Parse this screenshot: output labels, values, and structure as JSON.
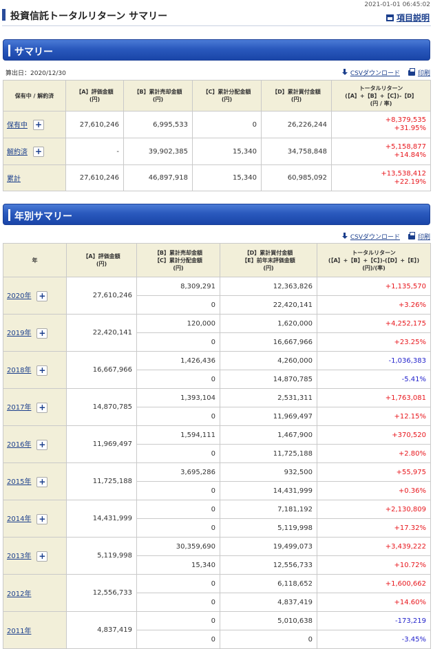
{
  "timestamp": "2021-01-01 06:45:02",
  "page_title": "投資信託トータルリターン サマリー",
  "help_link": "項目説明",
  "summary": {
    "heading": "サマリー",
    "calc_date": "算出日：2020/12/30",
    "csv_label": "CSVダウンロード",
    "print_label": "印刷",
    "headers": {
      "col0": "保有中 / 解約済",
      "colA": "【A】評価金額\n(円)",
      "colB": "【B】累計売却金額\n(円)",
      "colC": "【C】累計分配金額\n(円)",
      "colD": "【D】累計買付金額\n(円)",
      "colE": "トータルリターン\n(【A】+【B】+【C】)-【D】\n(円 / 率)"
    },
    "rows": [
      {
        "label": "保有中",
        "expand": "+",
        "a": "27,610,246",
        "b": "6,995,533",
        "c": "0",
        "d": "26,226,244",
        "ret_amount": "+8,379,535",
        "ret_rate": "+31.95%"
      },
      {
        "label": "解約済",
        "expand": "+",
        "a": "-",
        "b": "39,902,385",
        "c": "15,340",
        "d": "34,758,848",
        "ret_amount": "+5,158,877",
        "ret_rate": "+14.84%"
      },
      {
        "label": "累計",
        "a": "27,610,246",
        "b": "46,897,918",
        "c": "15,340",
        "d": "60,985,092",
        "ret_amount": "+13,538,412",
        "ret_rate": "+22.19%"
      }
    ]
  },
  "yearly": {
    "heading": "年別サマリー",
    "csv_label": "CSVダウンロード",
    "print_label": "印刷",
    "headers": {
      "year": "年",
      "a": "【A】評価金額\n(円)",
      "bc": "【B】累計売却金額\n【C】累計分配金額\n(円)",
      "de": "【D】累計買付金額\n【E】前年末評価金額\n(円)",
      "ret": "トータルリターン\n(【A】+【B】+【C】)-(【D】+【E】)\n(円)/(率)"
    },
    "rows": [
      {
        "year": "2020年",
        "expand": "+",
        "a": "27,610,246",
        "b": "8,309,291",
        "c": "0",
        "d": "12,363,826",
        "e": "22,420,141",
        "ret_amount": "+1,135,570",
        "ret_rate": "+3.26%",
        "sign": "pos"
      },
      {
        "year": "2019年",
        "expand": "+",
        "a": "22,420,141",
        "b": "120,000",
        "c": "0",
        "d": "1,620,000",
        "e": "16,667,966",
        "ret_amount": "+4,252,175",
        "ret_rate": "+23.25%",
        "sign": "pos"
      },
      {
        "year": "2018年",
        "expand": "+",
        "a": "16,667,966",
        "b": "1,426,436",
        "c": "0",
        "d": "4,260,000",
        "e": "14,870,785",
        "ret_amount": "-1,036,383",
        "ret_rate": "-5.41%",
        "sign": "neg"
      },
      {
        "year": "2017年",
        "expand": "+",
        "a": "14,870,785",
        "b": "1,393,104",
        "c": "0",
        "d": "2,531,311",
        "e": "11,969,497",
        "ret_amount": "+1,763,081",
        "ret_rate": "+12.15%",
        "sign": "pos"
      },
      {
        "year": "2016年",
        "expand": "+",
        "a": "11,969,497",
        "b": "1,594,111",
        "c": "0",
        "d": "1,467,900",
        "e": "11,725,188",
        "ret_amount": "+370,520",
        "ret_rate": "+2.80%",
        "sign": "pos"
      },
      {
        "year": "2015年",
        "expand": "+",
        "a": "11,725,188",
        "b": "3,695,286",
        "c": "0",
        "d": "932,500",
        "e": "14,431,999",
        "ret_amount": "+55,975",
        "ret_rate": "+0.36%",
        "sign": "pos"
      },
      {
        "year": "2014年",
        "expand": "+",
        "a": "14,431,999",
        "b": "0",
        "c": "0",
        "d": "7,181,192",
        "e": "5,119,998",
        "ret_amount": "+2,130,809",
        "ret_rate": "+17.32%",
        "sign": "pos"
      },
      {
        "year": "2013年",
        "expand": "+",
        "a": "5,119,998",
        "b": "30,359,690",
        "c": "15,340",
        "d": "19,499,073",
        "e": "12,556,733",
        "ret_amount": "+3,439,222",
        "ret_rate": "+10.72%",
        "sign": "pos"
      },
      {
        "year": "2012年",
        "a": "12,556,733",
        "b": "0",
        "c": "0",
        "d": "6,118,652",
        "e": "4,837,419",
        "ret_amount": "+1,600,662",
        "ret_rate": "+14.60%",
        "sign": "pos"
      },
      {
        "year": "2011年",
        "a": "4,837,419",
        "b": "0",
        "c": "0",
        "d": "5,010,638",
        "e": "0",
        "ret_amount": "-173,219",
        "ret_rate": "-3.45%",
        "sign": "neg"
      }
    ]
  }
}
